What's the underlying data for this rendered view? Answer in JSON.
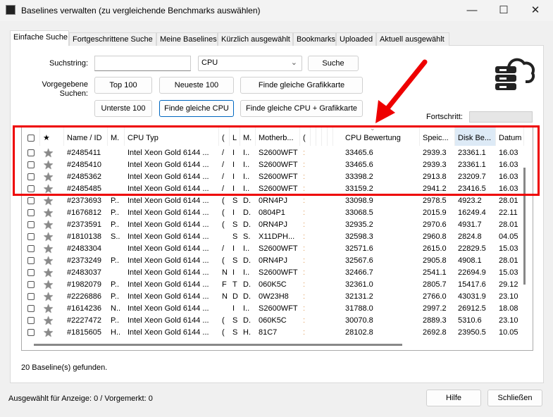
{
  "window": {
    "title": "Baselines verwalten (zu vergleichende Benchmarks auswählen)",
    "minimize": "—",
    "maximize": "☐",
    "close": "✕"
  },
  "tabs": [
    "Einfache Suche",
    "Fortgeschrittene Suche",
    "Meine Baselines",
    "Kürzlich ausgewählt",
    "Bookmarks",
    "Uploaded",
    "Aktuell ausgewählt"
  ],
  "search": {
    "label": "Suchstring:",
    "value": "",
    "category": "CPU",
    "button": "Suche"
  },
  "presets": {
    "label": "Vorgegebene Suchen:",
    "top100": "Top 100",
    "newest100": "Neueste 100",
    "same_gpu": "Finde gleiche Grafikkarte",
    "bottom100": "Unterste 100",
    "same_cpu": "Finde gleiche CPU",
    "same_cpu_gpu": "Finde gleiche CPU + Grafikkarte"
  },
  "progress": {
    "label": "Fortschritt:",
    "value": 0
  },
  "table": {
    "headers": [
      "",
      "★",
      "Name / ID",
      "M.",
      "CPU Typ",
      "(",
      "L",
      "M.",
      "Motherb...",
      "(",
      "",
      "",
      "",
      "",
      "CPU Bewertung",
      "Speic...",
      "Disk Be...",
      "Datum"
    ],
    "sorted_column": "CPU Bewertung",
    "rows": [
      [
        "#2485411",
        "",
        "Intel Xeon Gold 6144 ...",
        "/",
        "I",
        "I..",
        "S2600WFT",
        ":",
        "33465.6",
        "2939.3",
        "23361.1",
        "16.03"
      ],
      [
        "#2485410",
        "",
        "Intel Xeon Gold 6144 ...",
        "/",
        "I",
        "I..",
        "S2600WFT",
        ":",
        "33465.6",
        "2939.3",
        "23361.1",
        "16.03"
      ],
      [
        "#2485362",
        "",
        "Intel Xeon Gold 6144 ...",
        "/",
        "I",
        "I..",
        "S2600WFT",
        ":",
        "33398.2",
        "2913.8",
        "23209.7",
        "16.03"
      ],
      [
        "#2485485",
        "",
        "Intel Xeon Gold 6144 ...",
        "/",
        "I",
        "I..",
        "S2600WFT",
        ":",
        "33159.2",
        "2941.2",
        "23416.5",
        "16.03"
      ],
      [
        "#2373693",
        "P..",
        "Intel Xeon Gold 6144 ...",
        "(",
        "S",
        "D.",
        "0RN4PJ",
        ":",
        "33098.9",
        "2978.5",
        "4923.2",
        "28.01"
      ],
      [
        "#1676812",
        "P..",
        "Intel Xeon Gold 6144 ...",
        "(",
        "I",
        "D.",
        "0804P1",
        ":",
        "33068.5",
        "2015.9",
        "16249.4",
        "22.11"
      ],
      [
        "#2373591",
        "P..",
        "Intel Xeon Gold 6144 ...",
        "(",
        "S",
        "D.",
        "0RN4PJ",
        ":",
        "32935.2",
        "2970.6",
        "4931.7",
        "28.01"
      ],
      [
        "#1810138",
        "S..",
        "Intel Xeon Gold 6144 ...",
        "",
        "S",
        "S.",
        "X11DPH...",
        ":",
        "32598.3",
        "2960.8",
        "2824.8",
        "04.05"
      ],
      [
        "#2483304",
        "",
        "Intel Xeon Gold 6144 ...",
        "/",
        "I",
        "I..",
        "S2600WFT",
        ":",
        "32571.6",
        "2615.0",
        "22829.5",
        "15.03"
      ],
      [
        "#2373249",
        "P..",
        "Intel Xeon Gold 6144 ...",
        "(",
        "S",
        "D.",
        "0RN4PJ",
        ":",
        "32567.6",
        "2905.8",
        "4908.1",
        "28.01"
      ],
      [
        "#2483037",
        "",
        "Intel Xeon Gold 6144 ...",
        "N",
        "I",
        "I..",
        "S2600WFT",
        ":",
        "32466.7",
        "2541.1",
        "22694.9",
        "15.03"
      ],
      [
        "#1982079",
        "P..",
        "Intel Xeon Gold 6144 ...",
        "F",
        "T",
        "D.",
        "060K5C",
        ":",
        "32361.0",
        "2805.7",
        "15417.6",
        "29.12"
      ],
      [
        "#2226886",
        "P..",
        "Intel Xeon Gold 6144 ...",
        "N",
        "D",
        "D.",
        "0W23H8",
        ":",
        "32131.2",
        "2766.0",
        "43031.9",
        "23.10"
      ],
      [
        "#1614236",
        "N..",
        "Intel Xeon Gold 6144 ...",
        "",
        "I",
        "I..",
        "S2600WFT",
        ":",
        "31788.0",
        "2997.2",
        "26912.5",
        "18.08"
      ],
      [
        "#2227472",
        "P..",
        "Intel Xeon Gold 6144 ...",
        "(",
        "S",
        "D.",
        "060K5C",
        ":",
        "30070.8",
        "2889.3",
        "5310.6",
        "23.10"
      ],
      [
        "#1815605",
        "H..",
        "Intel Xeon Gold 6144 ...",
        "(",
        "S",
        "H.",
        "81C7",
        ":",
        "28102.8",
        "2692.8",
        "23950.5",
        "10.05"
      ]
    ]
  },
  "status": {
    "found": "20 Baseline(s) gefunden.",
    "selected": "Ausgewählt für Anzeige: 0 / Vorgemerkt: 0"
  },
  "footer": {
    "help": "Hilfe",
    "close": "Schließen"
  },
  "colors": {
    "highlight": "#e00000",
    "accent": "#0067c0"
  }
}
